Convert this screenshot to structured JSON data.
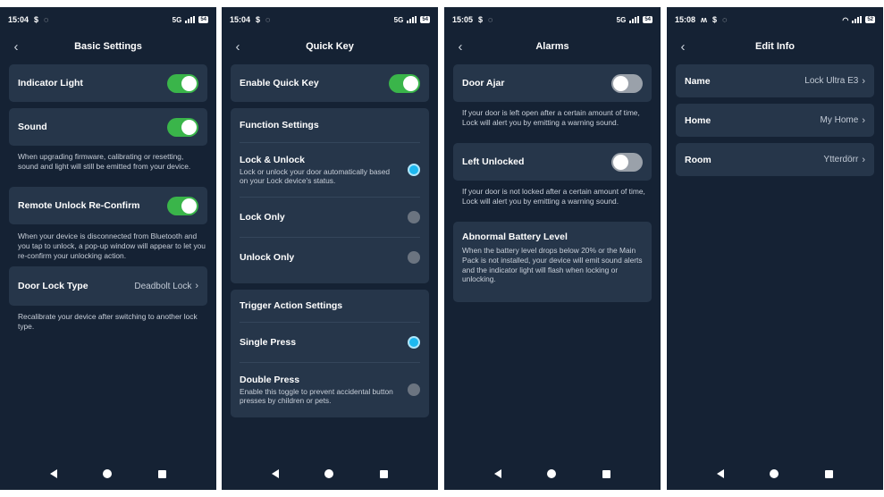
{
  "screens": [
    {
      "status": {
        "time": "15:04",
        "network": "5G",
        "battery": "54"
      },
      "title": "Basic Settings",
      "items": {
        "indicator_light": {
          "label": "Indicator Light",
          "on": true
        },
        "sound": {
          "label": "Sound",
          "on": true,
          "note": "When upgrading firmware, calibrating or resetting, sound and light will still be emitted from your device."
        },
        "remote_unlock": {
          "label": "Remote Unlock Re-Confirm",
          "on": true,
          "note": "When your device is disconnected from Bluetooth and you tap to unlock, a pop-up window will appear to let you re-confirm your unlocking action."
        },
        "door_lock_type": {
          "label": "Door Lock Type",
          "value": "Deadbolt Lock",
          "note": "Recalibrate your device after switching to another lock type."
        }
      }
    },
    {
      "status": {
        "time": "15:04",
        "network": "5G",
        "battery": "54"
      },
      "title": "Quick Key",
      "enable": {
        "label": "Enable Quick Key",
        "on": true
      },
      "function_settings": {
        "header": "Function Settings",
        "lock_unlock": {
          "label": "Lock & Unlock",
          "desc": "Lock or unlock your door automatically based on your Lock device's status.",
          "selected": true
        },
        "lock_only": {
          "label": "Lock Only",
          "selected": false
        },
        "unlock_only": {
          "label": "Unlock Only",
          "selected": false
        }
      },
      "trigger_settings": {
        "header": "Trigger Action Settings",
        "single_press": {
          "label": "Single Press",
          "selected": true
        },
        "double_press": {
          "label": "Double Press",
          "desc": "Enable this toggle to prevent accidental button presses by children or pets.",
          "selected": false
        }
      }
    },
    {
      "status": {
        "time": "15:05",
        "network": "5G",
        "battery": "54"
      },
      "title": "Alarms",
      "door_ajar": {
        "label": "Door Ajar",
        "on": false,
        "note": "If your door is left open after a certain amount of time, Lock will alert you by emitting a warning sound."
      },
      "left_unlocked": {
        "label": "Left Unlocked",
        "on": false,
        "note": "If your door is not locked after a certain amount of time, Lock will alert you by emitting a warning sound."
      },
      "abnormal_battery": {
        "label": "Abnormal Battery Level",
        "desc": "When the battery level drops below 20% or the Main Pack is not installed, your device will emit sound alerts and the indicator light will flash when locking or unlocking."
      }
    },
    {
      "status": {
        "time": "15:08",
        "battery": "52"
      },
      "title": "Edit Info",
      "name": {
        "label": "Name",
        "value": "Lock Ultra E3"
      },
      "home": {
        "label": "Home",
        "value": "My Home"
      },
      "room": {
        "label": "Room",
        "value": "Ytterdörr"
      }
    }
  ],
  "icons": {
    "back": "chevron-left-icon",
    "chevron": "chevron-right-icon",
    "nav_back": "nav-back-icon",
    "nav_home": "nav-home-icon",
    "nav_recent": "nav-recent-icon"
  },
  "colors": {
    "background": "#152234",
    "card": "#26364a",
    "toggle_on": "#3ab54a",
    "toggle_off": "#9aa1aa",
    "radio_selected": "#1db8f0",
    "radio_unselected": "#6b7480"
  }
}
